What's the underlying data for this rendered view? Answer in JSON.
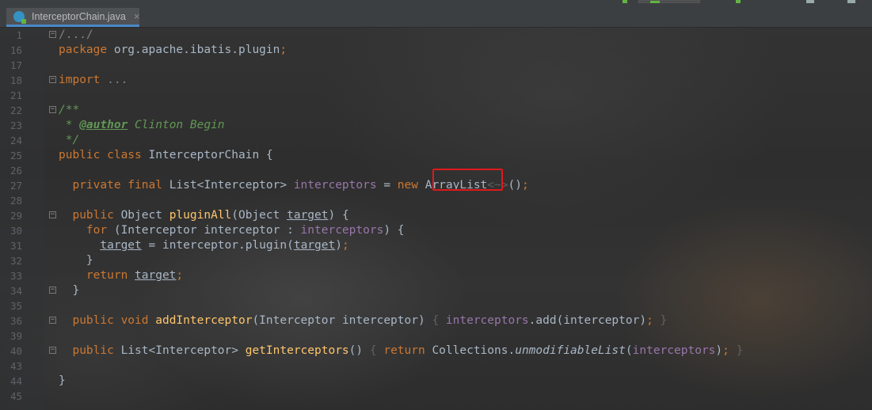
{
  "tab": {
    "filename": "InterceptorChain.java",
    "close": "×"
  },
  "lines": [
    {
      "n": "1",
      "parts": [
        [
          "pl",
          "/.../"
        ]
      ],
      "fold": true
    },
    {
      "n": "16",
      "parts": [
        [
          "kw",
          "package "
        ],
        [
          "tx",
          "org.apache.ibatis.plugin"
        ],
        [
          "kw",
          ";"
        ]
      ]
    },
    {
      "n": "17",
      "parts": []
    },
    {
      "n": "18",
      "parts": [
        [
          "kw",
          "import "
        ],
        [
          "pl",
          "..."
        ]
      ],
      "fold": true
    },
    {
      "n": "21",
      "parts": []
    },
    {
      "n": "22",
      "parts": [
        [
          "cmt",
          "/**"
        ]
      ],
      "fold": true
    },
    {
      "n": "23",
      "parts": [
        [
          "cmt",
          " * "
        ],
        [
          "tag",
          "@author"
        ],
        [
          "cmt",
          " Clinton Begin"
        ]
      ]
    },
    {
      "n": "24",
      "parts": [
        [
          "cmt",
          " */"
        ]
      ]
    },
    {
      "n": "25",
      "parts": [
        [
          "kw",
          "public class "
        ],
        [
          "tx",
          "InterceptorChain {"
        ]
      ]
    },
    {
      "n": "26",
      "parts": []
    },
    {
      "n": "27",
      "parts": [
        [
          "tx",
          "  "
        ],
        [
          "kw",
          "private final "
        ],
        [
          "tx",
          "List<Interceptor> "
        ],
        [
          "fld",
          "interceptors"
        ],
        [
          "tx",
          " = "
        ],
        [
          "kw",
          "new "
        ],
        [
          "tx",
          "ArrayList"
        ],
        [
          "dim",
          "<~>"
        ],
        [
          "tx",
          "()"
        ],
        [
          "kw",
          ";"
        ]
      ]
    },
    {
      "n": "28",
      "parts": []
    },
    {
      "n": "29",
      "parts": [
        [
          "tx",
          "  "
        ],
        [
          "kw",
          "public "
        ],
        [
          "tx",
          "Object "
        ],
        [
          "fn",
          "pluginAll"
        ],
        [
          "tx",
          "(Object "
        ],
        [
          "ul",
          "target"
        ],
        [
          "tx",
          ") {"
        ]
      ],
      "fold": true
    },
    {
      "n": "30",
      "parts": [
        [
          "tx",
          "    "
        ],
        [
          "kw",
          "for "
        ],
        [
          "tx",
          "(Interceptor interceptor : "
        ],
        [
          "fld",
          "interceptors"
        ],
        [
          "tx",
          ") {"
        ]
      ]
    },
    {
      "n": "31",
      "parts": [
        [
          "tx",
          "      "
        ],
        [
          "ul",
          "target"
        ],
        [
          "tx",
          " = interceptor.plugin("
        ],
        [
          "ul",
          "target"
        ],
        [
          "tx",
          ")"
        ],
        [
          "kw",
          ";"
        ]
      ]
    },
    {
      "n": "32",
      "parts": [
        [
          "tx",
          "    }"
        ]
      ]
    },
    {
      "n": "33",
      "parts": [
        [
          "tx",
          "    "
        ],
        [
          "kw",
          "return "
        ],
        [
          "ul",
          "target"
        ],
        [
          "kw",
          ";"
        ]
      ]
    },
    {
      "n": "34",
      "parts": [
        [
          "tx",
          "  }"
        ]
      ],
      "fold": true
    },
    {
      "n": "35",
      "parts": []
    },
    {
      "n": "36",
      "parts": [
        [
          "tx",
          "  "
        ],
        [
          "kw",
          "public void "
        ],
        [
          "fn",
          "addInterceptor"
        ],
        [
          "tx",
          "(Interceptor interceptor) "
        ],
        [
          "dim",
          "{ "
        ],
        [
          "fld",
          "interceptors"
        ],
        [
          "tx",
          ".add(interceptor)"
        ],
        [
          "kw",
          ";"
        ],
        [
          "dim",
          " }"
        ]
      ],
      "fold": true
    },
    {
      "n": "39",
      "parts": []
    },
    {
      "n": "40",
      "parts": [
        [
          "tx",
          "  "
        ],
        [
          "kw",
          "public "
        ],
        [
          "tx",
          "List<Interceptor> "
        ],
        [
          "fn",
          "getInterceptors"
        ],
        [
          "tx",
          "() "
        ],
        [
          "dim",
          "{ "
        ],
        [
          "kw",
          "return "
        ],
        [
          "tx",
          "Collections."
        ],
        [
          "it",
          "unmodifiableList"
        ],
        [
          "tx",
          "("
        ],
        [
          "fld",
          "interceptors"
        ],
        [
          "tx",
          ")"
        ],
        [
          "kw",
          ";"
        ],
        [
          "dim",
          " }"
        ]
      ],
      "fold": true
    },
    {
      "n": "43",
      "parts": []
    },
    {
      "n": "44",
      "parts": [
        [
          "tx",
          "}"
        ]
      ]
    },
    {
      "n": "45",
      "parts": []
    }
  ],
  "highlight": {
    "line": "27",
    "text": "ArrayList",
    "color": "#e0191b"
  },
  "colors": {
    "keyword": "#cc7832",
    "method": "#ffc66d",
    "field": "#9876aa",
    "comment": "#629755",
    "text": "#a9b7c6",
    "lineNumber": "#606366"
  }
}
